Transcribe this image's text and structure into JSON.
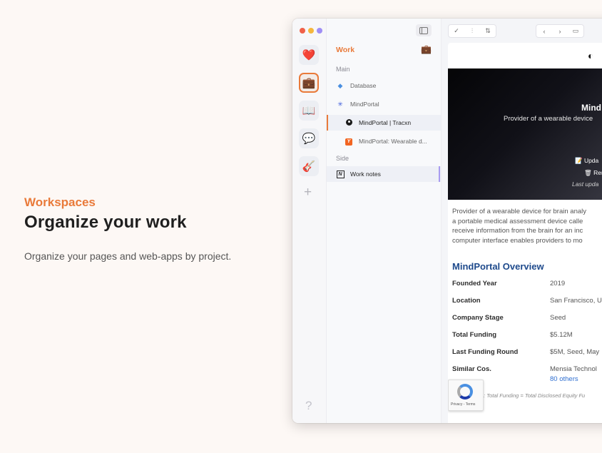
{
  "intro": {
    "eyebrow": "Workspaces",
    "headline": "Organize your work",
    "subtitle": "Organize your pages and web-apps by project.",
    "accent_color": "#e97a3a"
  },
  "rail": {
    "items": [
      {
        "name": "heart-icon",
        "glyph": "❤️"
      },
      {
        "name": "briefcase-icon",
        "glyph": "💼",
        "active": true
      },
      {
        "name": "book-icon",
        "glyph": "📖"
      },
      {
        "name": "chat-bubble-icon",
        "glyph": "💬"
      },
      {
        "name": "guitar-icon",
        "glyph": "🎸"
      }
    ],
    "add_glyph": "+",
    "help_glyph": "?"
  },
  "sidebar": {
    "workspace_title": "Work",
    "workspace_icon": "💼",
    "sections": {
      "main": "Main",
      "side": "Side"
    },
    "items": [
      {
        "label": "Database",
        "icon": "database-icon"
      },
      {
        "label": "MindPortal",
        "icon": "asterisk-icon"
      },
      {
        "label": "MindPortal | Tracxn",
        "icon": "tracxn-icon",
        "selected": true
      },
      {
        "label": "MindPortal: Wearable d...",
        "icon": "y-combinator-icon"
      },
      {
        "label": "Work notes",
        "icon": "notion-icon"
      }
    ]
  },
  "page": {
    "hero": {
      "title": "Mind",
      "subtitle": "Provider of a wearable device",
      "update": "📝 Upda",
      "remove": "🗑 Ren",
      "last_updated": "Last upda"
    },
    "description": [
      "Provider of a wearable device for brain analy",
      "a portable medical assessment device calle",
      "receive information from the brain for an inc",
      "computer interface enables providers to mo"
    ],
    "overview_title": "MindPortal Overview",
    "overview": [
      {
        "key": "Founded Year",
        "value": "2019"
      },
      {
        "key": "Location",
        "value": "San Francisco, U"
      },
      {
        "key": "Company Stage",
        "value": "Seed"
      },
      {
        "key": "Total Funding",
        "value": "$5.12M"
      },
      {
        "key": "Last Funding Round",
        "value": "$5M, Seed, May"
      },
      {
        "key": "Similar Cos.",
        "value": "Mensia Technol"
      }
    ],
    "others_link": "80 others",
    "footnote": ": Total Funding = Total Disclosed Equity Fu",
    "captcha_text": "Privacy - Terms"
  }
}
